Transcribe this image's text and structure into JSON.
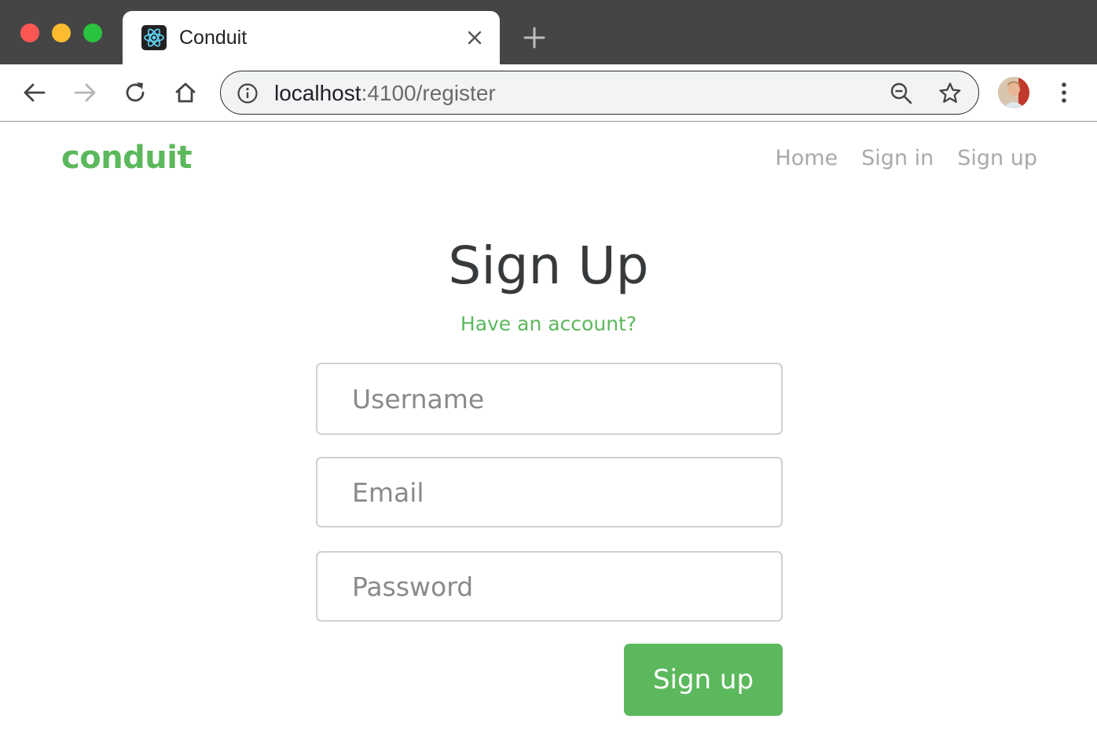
{
  "browser": {
    "tab_title": "Conduit",
    "url_host": "localhost",
    "url_path": ":4100/register",
    "colors": {
      "titlebar": "#454545",
      "traffic_red": "#fd5753",
      "traffic_yellow": "#fdbb2f",
      "traffic_green": "#29c33f"
    },
    "icons": [
      "react-favicon-icon",
      "close-icon",
      "plus-icon",
      "back-arrow-icon",
      "forward-arrow-icon",
      "reload-icon",
      "home-icon",
      "info-icon",
      "zoom-out-icon",
      "star-icon",
      "avatar",
      "kebab-menu-icon"
    ]
  },
  "navbar": {
    "brand": "conduit",
    "links": [
      {
        "label": "Home"
      },
      {
        "label": "Sign in"
      },
      {
        "label": "Sign up"
      }
    ]
  },
  "form": {
    "title": "Sign Up",
    "have_account_link": "Have an account?",
    "username": {
      "placeholder": "Username",
      "value": ""
    },
    "email": {
      "placeholder": "Email",
      "value": ""
    },
    "password": {
      "placeholder": "Password",
      "value": ""
    },
    "submit_label": "Sign up"
  },
  "theme": {
    "brand_color": "#5cb85c",
    "text_color": "#373a3c",
    "muted_color": "#a9a9a9"
  }
}
